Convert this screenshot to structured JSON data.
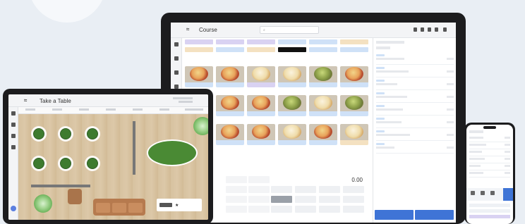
{
  "colors": {
    "accent_blue": "#3f74d6",
    "lavender": "#d9d2f2",
    "light_blue": "#cfe1f7",
    "table_green": "#3e7b2f",
    "floor_wood": "#d7c2a0",
    "device_frame": "#1c1c1e"
  },
  "icons": [
    "gear-icon",
    "search-icon",
    "menu-icon",
    "plant-icon"
  ],
  "desktop": {
    "app_title": "Course",
    "keypad_display": "0.00"
  },
  "tablet": {
    "app_title": "Take a Table"
  }
}
